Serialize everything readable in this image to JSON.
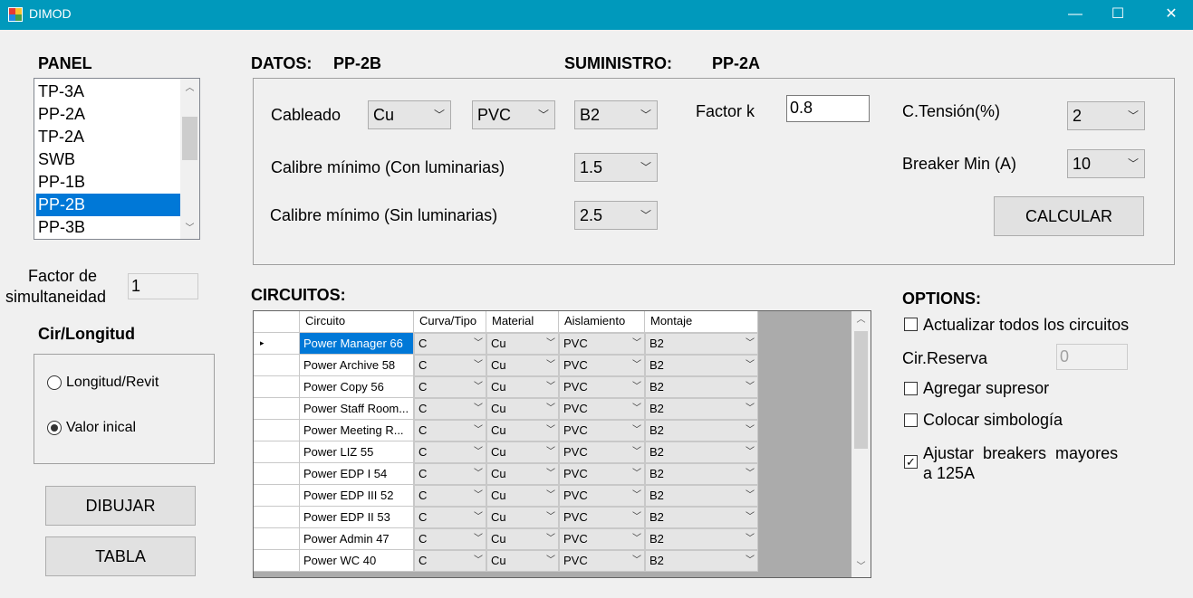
{
  "window": {
    "title": "DIMOD",
    "minimize": "—",
    "maximize": "☐",
    "close": "✕"
  },
  "panel": {
    "heading": "PANEL",
    "items": [
      "TP-3A",
      "PP-2A",
      "TP-2A",
      "SWB",
      "PP-1B",
      "PP-2B",
      "PP-3B"
    ],
    "selected": "PP-2B"
  },
  "factor": {
    "label_line1": "Factor de",
    "label_line2": "simultaneidad",
    "value": "1"
  },
  "cir_longitud": {
    "heading": "Cir/Longitud",
    "option1": "Longitud/Revit",
    "option2": "Valor inical",
    "selected": "Valor inical"
  },
  "buttons": {
    "dibujar": "DIBUJAR",
    "tabla": "TABLA",
    "calcular": "CALCULAR"
  },
  "datos": {
    "label": "DATOS:",
    "value": "PP-2B"
  },
  "suministro": {
    "label": "SUMINISTRO:",
    "value": "PP-2A"
  },
  "settings": {
    "cableado_label": "Cableado",
    "cableado_material": "Cu",
    "cableado_aislamiento": "PVC",
    "cableado_montaje": "B2",
    "factor_k_label": "Factor k",
    "factor_k_value": "0.8",
    "ctension_label": "C.Tensión(%)",
    "ctension_value": "2",
    "breaker_label": "Breaker Min (A)",
    "breaker_value": "10",
    "calibre_con_label": "Calibre mínimo (Con luminarias)",
    "calibre_con_value": "1.5",
    "calibre_sin_label": "Calibre mínimo (Sin luminarias)",
    "calibre_sin_value": "2.5"
  },
  "circuitos": {
    "heading": "CIRCUITOS:",
    "columns": [
      "Circuito",
      "Curva/Tipo",
      "Material",
      "Aislamiento",
      "Montaje"
    ],
    "rows": [
      {
        "circuito": "Power Manager 66",
        "curva": "C",
        "material": "Cu",
        "aislamiento": "PVC",
        "montaje": "B2"
      },
      {
        "circuito": "Power Archive 58",
        "curva": "C",
        "material": "Cu",
        "aislamiento": "PVC",
        "montaje": "B2"
      },
      {
        "circuito": "Power Copy 56",
        "curva": "C",
        "material": "Cu",
        "aislamiento": "PVC",
        "montaje": "B2"
      },
      {
        "circuito": "Power Staff Room...",
        "curva": "C",
        "material": "Cu",
        "aislamiento": "PVC",
        "montaje": "B2"
      },
      {
        "circuito": "Power Meeting R...",
        "curva": "C",
        "material": "Cu",
        "aislamiento": "PVC",
        "montaje": "B2"
      },
      {
        "circuito": "Power LIZ 55",
        "curva": "C",
        "material": "Cu",
        "aislamiento": "PVC",
        "montaje": "B2"
      },
      {
        "circuito": "Power EDP I 54",
        "curva": "C",
        "material": "Cu",
        "aislamiento": "PVC",
        "montaje": "B2"
      },
      {
        "circuito": "Power EDP III 52",
        "curva": "C",
        "material": "Cu",
        "aislamiento": "PVC",
        "montaje": "B2"
      },
      {
        "circuito": "Power EDP II 53",
        "curva": "C",
        "material": "Cu",
        "aislamiento": "PVC",
        "montaje": "B2"
      },
      {
        "circuito": "Power Admin 47",
        "curva": "C",
        "material": "Cu",
        "aislamiento": "PVC",
        "montaje": "B2"
      },
      {
        "circuito": "Power WC 40",
        "curva": "C",
        "material": "Cu",
        "aislamiento": "PVC",
        "montaje": "B2"
      }
    ]
  },
  "options": {
    "heading": "OPTIONS:",
    "actualizar": "Actualizar todos los circuitos",
    "actualizar_checked": false,
    "cir_reserva_label": "Cir.Reserva",
    "cir_reserva_value": "0",
    "agregar": "Agregar supresor",
    "agregar_checked": false,
    "colocar": "Colocar simbología",
    "colocar_checked": false,
    "ajustar_line1": "Ajustar  breakers  mayores",
    "ajustar_line2": "a 125A",
    "ajustar_checked": true
  },
  "colors": {
    "titlebar": "#0099bc",
    "selection": "#0078d7"
  }
}
